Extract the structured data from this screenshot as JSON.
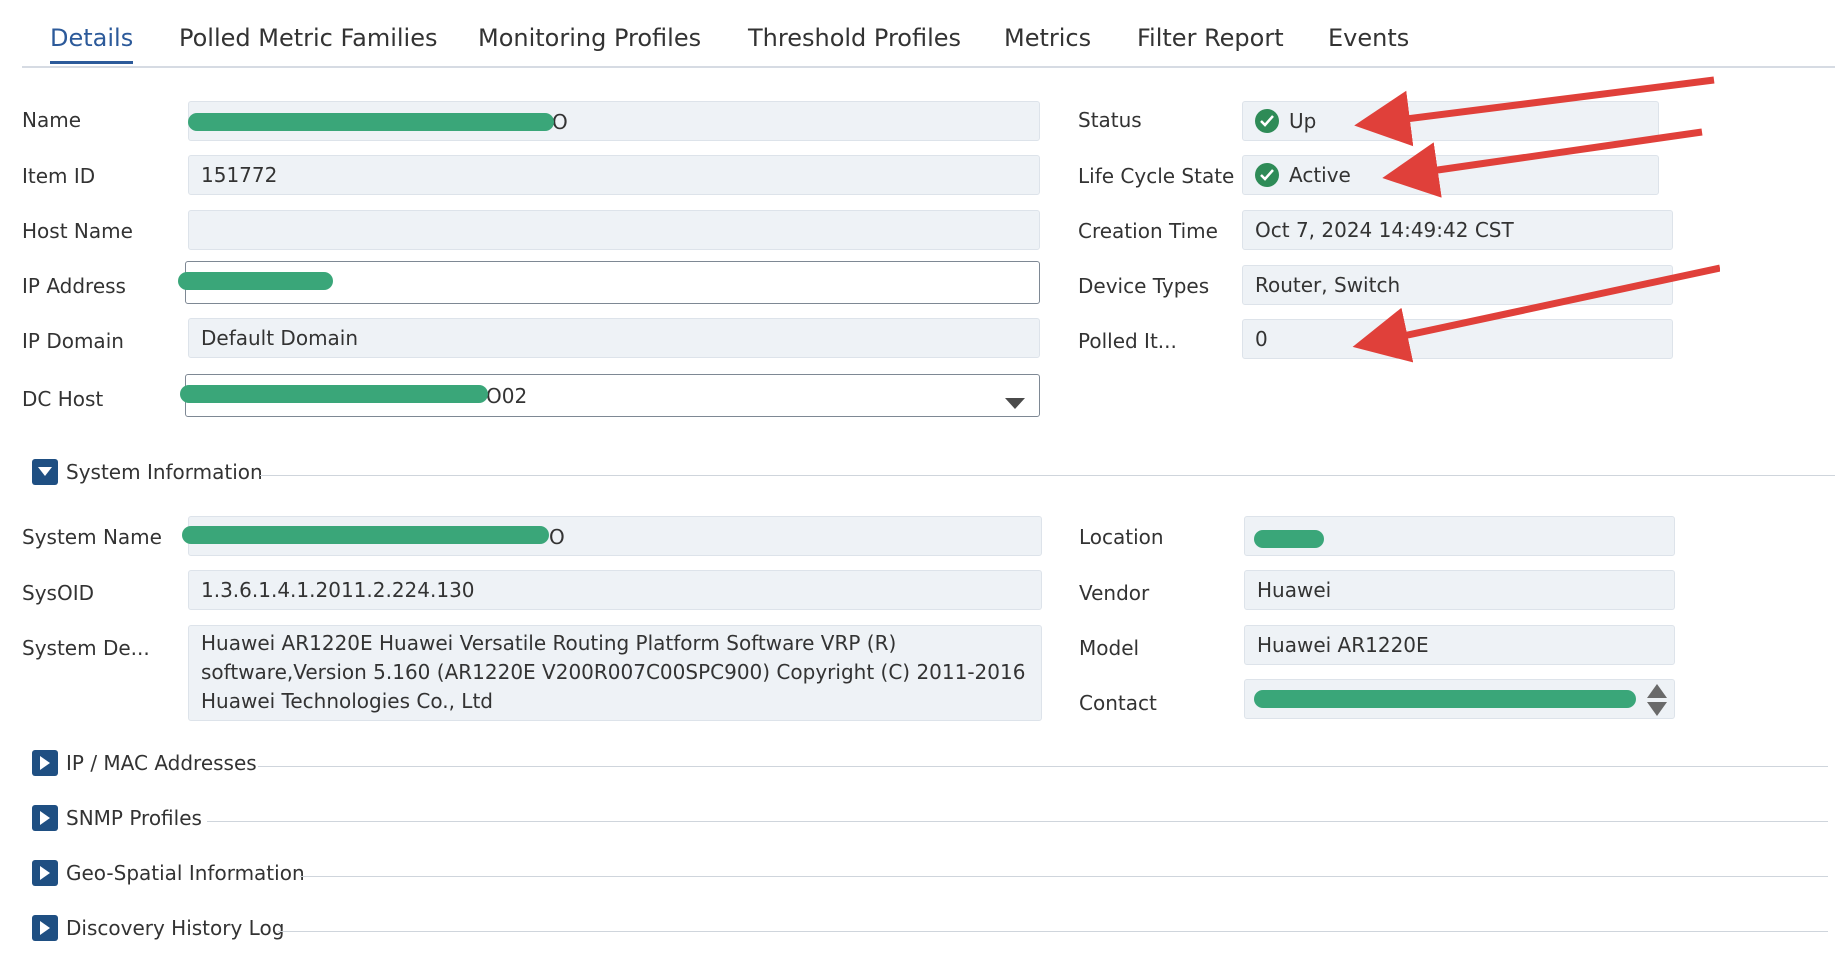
{
  "tabs": [
    {
      "label": "Details",
      "active": true
    },
    {
      "label": "Polled Metric Families"
    },
    {
      "label": "Monitoring Profiles"
    },
    {
      "label": "Threshold Profiles"
    },
    {
      "label": "Metrics"
    },
    {
      "label": "Filter Report"
    },
    {
      "label": "Events"
    }
  ],
  "details": {
    "name_label": "Name",
    "name_value_suffix": "O",
    "item_id_label": "Item ID",
    "item_id_value": "151772",
    "host_name_label": "Host Name",
    "host_name_value": "",
    "ip_address_label": "IP Address",
    "ip_domain_label": "IP Domain",
    "ip_domain_value": "Default Domain",
    "dc_host_label": "DC Host",
    "dc_host_value_suffix": "O02",
    "status_label": "Status",
    "status_value": "Up",
    "lifecycle_label": "Life Cycle State",
    "lifecycle_value": "Active",
    "creation_label": "Creation Time",
    "creation_value": "Oct 7, 2024 14:49:42 CST",
    "device_types_label": "Device Types",
    "device_types_value": "Router, Switch",
    "polled_label": "Polled It...",
    "polled_value": "0"
  },
  "system_info": {
    "title": "System Information",
    "system_name_label": "System Name",
    "system_name_suffix": "O",
    "sysoid_label": "SysOID",
    "sysoid_value": "1.3.6.1.4.1.2011.2.224.130",
    "sysdesc_label": "System De...",
    "sysdesc_value": "Huawei AR1220E Huawei Versatile Routing Platform Software VRP (R) software,Version 5.160 (AR1220E V200R007C00SPC900) Copyright (C) 2011-2016 Huawei Technologies Co., Ltd",
    "location_label": "Location",
    "vendor_label": "Vendor",
    "vendor_value": "Huawei",
    "model_label": "Model",
    "model_value": "Huawei AR1220E",
    "contact_label": "Contact"
  },
  "sections": [
    {
      "title": "IP / MAC Addresses"
    },
    {
      "title": "SNMP Profiles"
    },
    {
      "title": "Geo-Spatial Information"
    },
    {
      "title": "Discovery History Log"
    }
  ],
  "colors": {
    "accent": "#2c5a9a",
    "status_ok": "#2e8b57",
    "annotation_arrow": "#e0403a",
    "redaction": "#3aa679"
  }
}
